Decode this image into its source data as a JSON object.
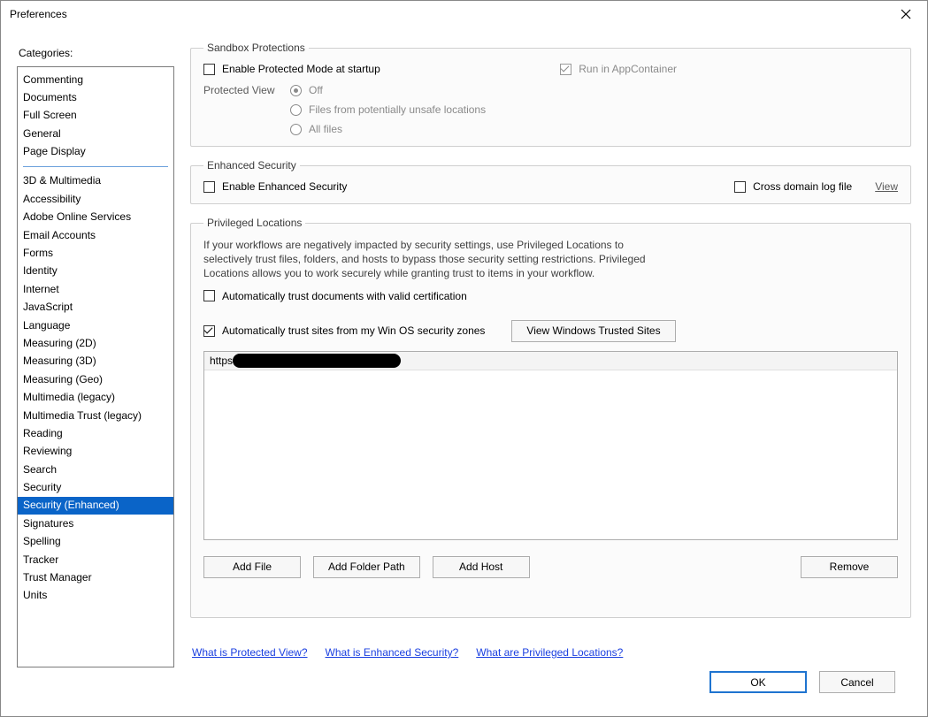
{
  "window": {
    "title": "Preferences"
  },
  "sidebar": {
    "label": "Categories:",
    "group1": [
      "Commenting",
      "Documents",
      "Full Screen",
      "General",
      "Page Display"
    ],
    "group2": [
      "3D & Multimedia",
      "Accessibility",
      "Adobe Online Services",
      "Email Accounts",
      "Forms",
      "Identity",
      "Internet",
      "JavaScript",
      "Language",
      "Measuring (2D)",
      "Measuring (3D)",
      "Measuring (Geo)",
      "Multimedia (legacy)",
      "Multimedia Trust (legacy)",
      "Reading",
      "Reviewing",
      "Search",
      "Security",
      "Security (Enhanced)",
      "Signatures",
      "Spelling",
      "Tracker",
      "Trust Manager",
      "Units"
    ],
    "selected": "Security (Enhanced)"
  },
  "sandbox": {
    "legend": "Sandbox Protections",
    "enable_protected_label": "Enable Protected Mode at startup",
    "enable_protected_checked": false,
    "run_appcontainer_label": "Run in AppContainer",
    "run_appcontainer_checked": true,
    "run_appcontainer_disabled": true,
    "protected_view_label": "Protected View",
    "pv_options": [
      "Off",
      "Files from potentially unsafe locations",
      "All files"
    ],
    "pv_selected_index": 0,
    "pv_disabled": true
  },
  "enhanced": {
    "legend": "Enhanced Security",
    "enable_label": "Enable Enhanced Security",
    "enable_checked": false,
    "cross_domain_label": "Cross domain log file",
    "cross_domain_checked": false,
    "view_link": "View"
  },
  "privileged": {
    "legend": "Privileged Locations",
    "description": "If your workflows are negatively impacted by security settings, use Privileged Locations to selectively trust files, folders, and hosts to bypass those security setting restrictions. Privileged Locations allows you to work securely while granting trust to items in your workflow.",
    "auto_cert_label": "Automatically trust documents with valid certification",
    "auto_cert_checked": false,
    "auto_zones_label": "Automatically trust sites from my Win OS security zones",
    "auto_zones_checked": true,
    "view_trusted_btn": "View Windows Trusted Sites",
    "host_prefix": "https",
    "add_file_btn": "Add File",
    "add_folder_btn": "Add Folder Path",
    "add_host_btn": "Add Host",
    "remove_btn": "Remove"
  },
  "help": {
    "protected_view": "What is Protected View?",
    "enhanced_security": "What is Enhanced Security?",
    "privileged_locations": "What are Privileged Locations?"
  },
  "footer": {
    "ok": "OK",
    "cancel": "Cancel"
  }
}
